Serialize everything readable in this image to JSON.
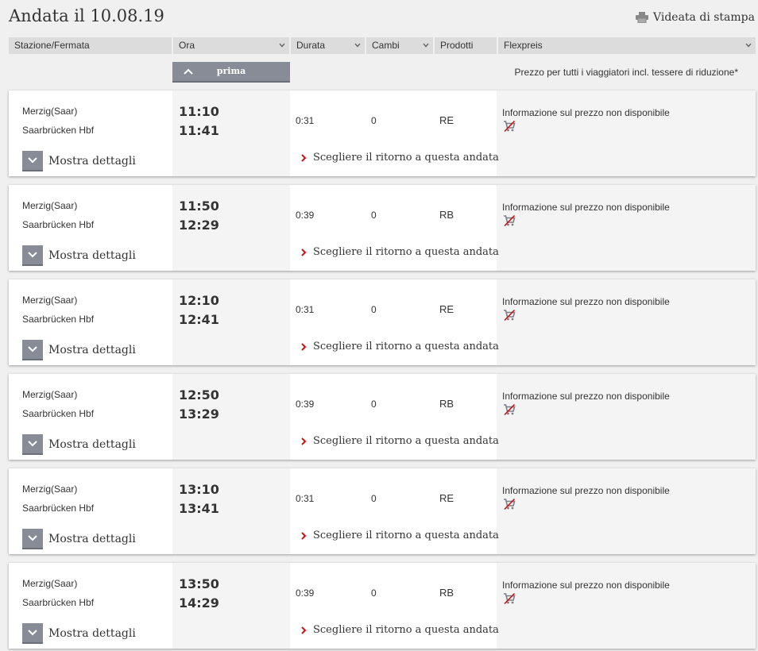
{
  "title": "Andata il 10.08.19",
  "print_label": "Videata di stampa",
  "columns": [
    {
      "label": "Stazione/Fermata",
      "sortable": false
    },
    {
      "label": "Ora",
      "sortable": true
    },
    {
      "label": "Durata",
      "sortable": true
    },
    {
      "label": "Cambi",
      "sortable": true
    },
    {
      "label": "Prodotti",
      "sortable": false
    },
    {
      "label": "Flexpreis",
      "sortable": true
    }
  ],
  "earlier_button": "prima",
  "price_note": "Prezzo per tutti i viaggiatori incl. tessere di riduzione*",
  "colors": {
    "accent_red": "#cc1111",
    "button_gray": "#878c96"
  },
  "connections": [
    {
      "from": "Merzig(Saar)",
      "to": "Saarbrücken Hbf",
      "dep": "11:10",
      "arr": "11:41",
      "duration": "0:31",
      "changes": "0",
      "product": "RE",
      "price_info": "Informazione sul prezzo non disponibile",
      "details_label": "Mostra dettagli",
      "return_label": "Scegliere il ritorno a questa andata"
    },
    {
      "from": "Merzig(Saar)",
      "to": "Saarbrücken Hbf",
      "dep": "11:50",
      "arr": "12:29",
      "duration": "0:39",
      "changes": "0",
      "product": "RB",
      "price_info": "Informazione sul prezzo non disponibile",
      "details_label": "Mostra dettagli",
      "return_label": "Scegliere il ritorno a questa andata"
    },
    {
      "from": "Merzig(Saar)",
      "to": "Saarbrücken Hbf",
      "dep": "12:10",
      "arr": "12:41",
      "duration": "0:31",
      "changes": "0",
      "product": "RE",
      "price_info": "Informazione sul prezzo non disponibile",
      "details_label": "Mostra dettagli",
      "return_label": "Scegliere il ritorno a questa andata"
    },
    {
      "from": "Merzig(Saar)",
      "to": "Saarbrücken Hbf",
      "dep": "12:50",
      "arr": "13:29",
      "duration": "0:39",
      "changes": "0",
      "product": "RB",
      "price_info": "Informazione sul prezzo non disponibile",
      "details_label": "Mostra dettagli",
      "return_label": "Scegliere il ritorno a questa andata"
    },
    {
      "from": "Merzig(Saar)",
      "to": "Saarbrücken Hbf",
      "dep": "13:10",
      "arr": "13:41",
      "duration": "0:31",
      "changes": "0",
      "product": "RE",
      "price_info": "Informazione sul prezzo non disponibile",
      "details_label": "Mostra dettagli",
      "return_label": "Scegliere il ritorno a questa andata"
    },
    {
      "from": "Merzig(Saar)",
      "to": "Saarbrücken Hbf",
      "dep": "13:50",
      "arr": "14:29",
      "duration": "0:39",
      "changes": "0",
      "product": "RB",
      "price_info": "Informazione sul prezzo non disponibile",
      "details_label": "Mostra dettagli",
      "return_label": "Scegliere il ritorno a questa andata"
    }
  ]
}
